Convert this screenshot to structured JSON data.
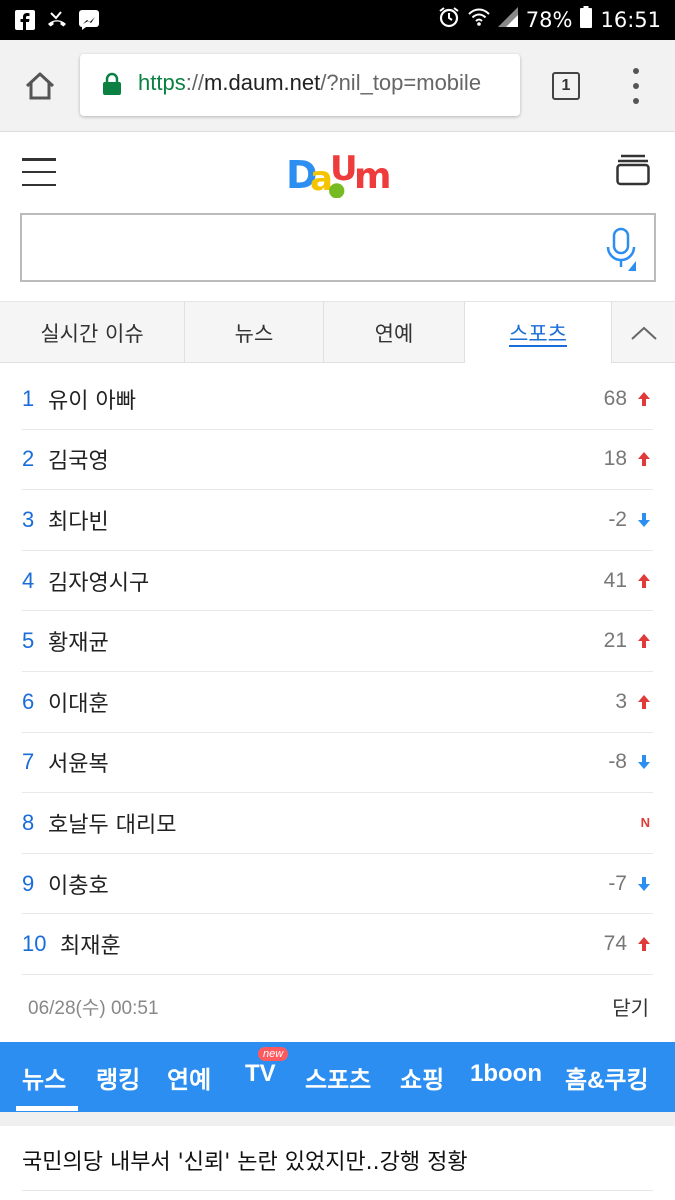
{
  "status_bar": {
    "battery": "78%",
    "time": "16:51",
    "left_icons": [
      "facebook-icon",
      "missed-call-icon",
      "messenger-icon"
    ],
    "right_icons": [
      "alarm-icon",
      "wifi-icon",
      "signal-icon",
      "battery-icon"
    ]
  },
  "browser": {
    "url_scheme": "https",
    "url_sep": "://",
    "url_host": "m.daum.net",
    "url_path": "/?nil_top=mobile",
    "tab_count": "1"
  },
  "header": {
    "logo": "Daum"
  },
  "search": {
    "placeholder": ""
  },
  "tabs": [
    {
      "label": "실시간 이슈",
      "active": false
    },
    {
      "label": "뉴스",
      "active": false
    },
    {
      "label": "연예",
      "active": false
    },
    {
      "label": "스포츠",
      "active": true
    }
  ],
  "ranking": [
    {
      "rank": "1",
      "term": "유이 아빠",
      "change": "68",
      "direction": "up"
    },
    {
      "rank": "2",
      "term": "김국영",
      "change": "18",
      "direction": "up"
    },
    {
      "rank": "3",
      "term": "최다빈",
      "change": "-2",
      "direction": "down"
    },
    {
      "rank": "4",
      "term": "김자영시구",
      "change": "41",
      "direction": "up"
    },
    {
      "rank": "5",
      "term": "황재균",
      "change": "21",
      "direction": "up"
    },
    {
      "rank": "6",
      "term": "이대훈",
      "change": "3",
      "direction": "up"
    },
    {
      "rank": "7",
      "term": "서윤복",
      "change": "-8",
      "direction": "down"
    },
    {
      "rank": "8",
      "term": "호날두 대리모",
      "change": "",
      "direction": "new",
      "badge": "N"
    },
    {
      "rank": "9",
      "term": "이충호",
      "change": "-7",
      "direction": "down"
    },
    {
      "rank": "10",
      "term": "최재훈",
      "change": "74",
      "direction": "up"
    }
  ],
  "ranking_footer": {
    "timestamp": "06/28(수) 00:51",
    "close_label": "닫기"
  },
  "colors": {
    "accent": "#1a6dd8",
    "nav_bg": "#2b8ef0",
    "up": "#e03a3a",
    "down": "#2b8ef0"
  },
  "nav": {
    "items": [
      "뉴스",
      "랭킹",
      "연예",
      "TV",
      "스포츠",
      "쇼핑",
      "1boon",
      "홈&쿠킹"
    ],
    "new_badge": "new"
  },
  "headline": "국민의당 내부서 '신뢰' 논란 있었지만..강행 정황"
}
